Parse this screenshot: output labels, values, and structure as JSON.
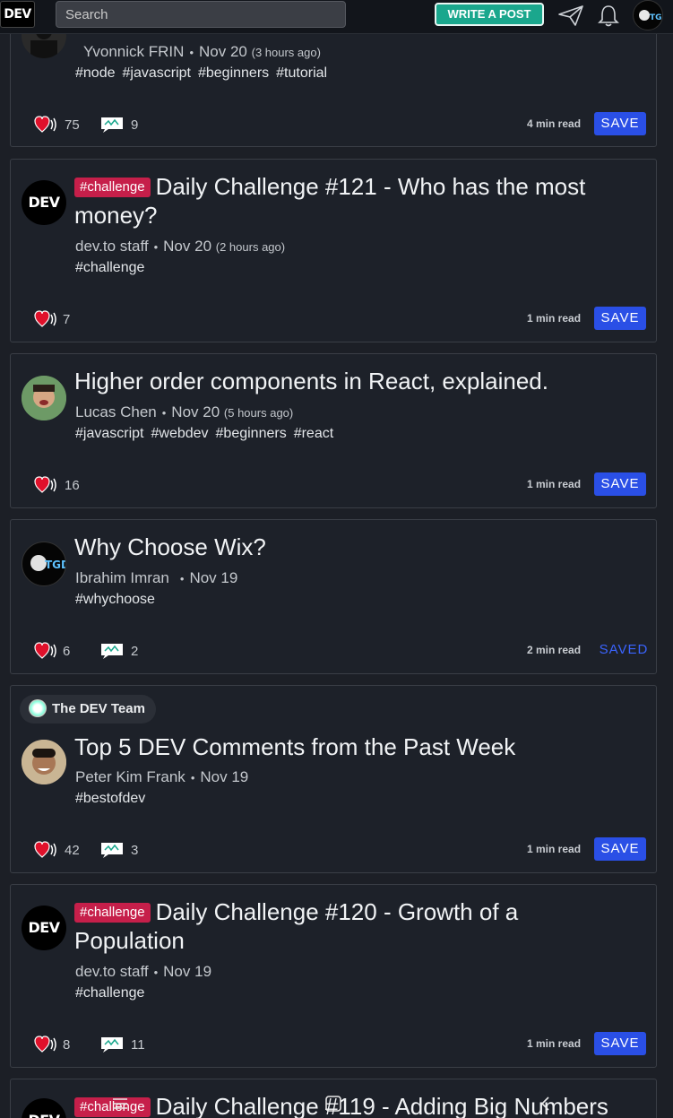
{
  "header": {
    "logo": "DEV",
    "search_placeholder": "Search",
    "write_button": "WRITE A POST",
    "icons": [
      "send-icon",
      "bell-icon",
      "avatar"
    ]
  },
  "posts": [
    {
      "author": "Yvonnick FRIN",
      "date": "Nov 20",
      "ago": "(3 hours ago)",
      "tags": [
        "#node",
        "#javascript",
        "#beginners",
        "#tutorial"
      ],
      "reactions": "75",
      "comments": "9",
      "read_time": "4 min read",
      "save": "SAVE"
    },
    {
      "tag_pill": "#challenge",
      "title": "Daily Challenge #121 - Who has the most money?",
      "avatar": "DEV",
      "author": "dev.to staff",
      "date": "Nov 20",
      "ago": "(2 hours ago)",
      "tags": [
        "#challenge"
      ],
      "reactions": "7",
      "read_time": "1 min read",
      "save": "SAVE"
    },
    {
      "title": "Higher order components in React, explained.",
      "author": "Lucas Chen",
      "date": "Nov 20",
      "ago": "(5 hours ago)",
      "tags": [
        "#javascript",
        "#webdev",
        "#beginners",
        "#react"
      ],
      "reactions": "16",
      "read_time": "1 min read",
      "save": "SAVE"
    },
    {
      "title": "Why Choose Wix?",
      "author": "Ibrahim Imran",
      "date": "Nov 19",
      "tags": [
        "#whychoose"
      ],
      "reactions": "6",
      "comments": "2",
      "read_time": "2 min read",
      "save": "SAVED"
    },
    {
      "org": "The DEV Team",
      "title": "Top 5 DEV Comments from the Past Week",
      "author": "Peter Kim Frank",
      "date": "Nov 19",
      "tags": [
        "#bestofdev"
      ],
      "reactions": "42",
      "comments": "3",
      "read_time": "1 min read",
      "save": "SAVE"
    },
    {
      "tag_pill": "#challenge",
      "title": "Daily Challenge #120 - Growth of a Population",
      "avatar": "DEV",
      "author": "dev.to staff",
      "date": "Nov 19",
      "tags": [
        "#challenge"
      ],
      "reactions": "8",
      "comments": "11",
      "read_time": "1 min read",
      "save": "SAVE"
    },
    {
      "tag_pill": "#challenge",
      "title": "Daily Challenge #119 - Adding Big Numbers",
      "avatar": "DEV"
    }
  ],
  "colors": {
    "background": "#1c1f26",
    "card": "#1d2129",
    "accent_blue": "#2a4fe6",
    "write_green": "#1aa78d",
    "challenge_pink": "#c61f4a",
    "heart_red": "#e0112b"
  },
  "bottom_nav": [
    "menu-icon",
    "new-post-icon",
    "back-icon"
  ]
}
